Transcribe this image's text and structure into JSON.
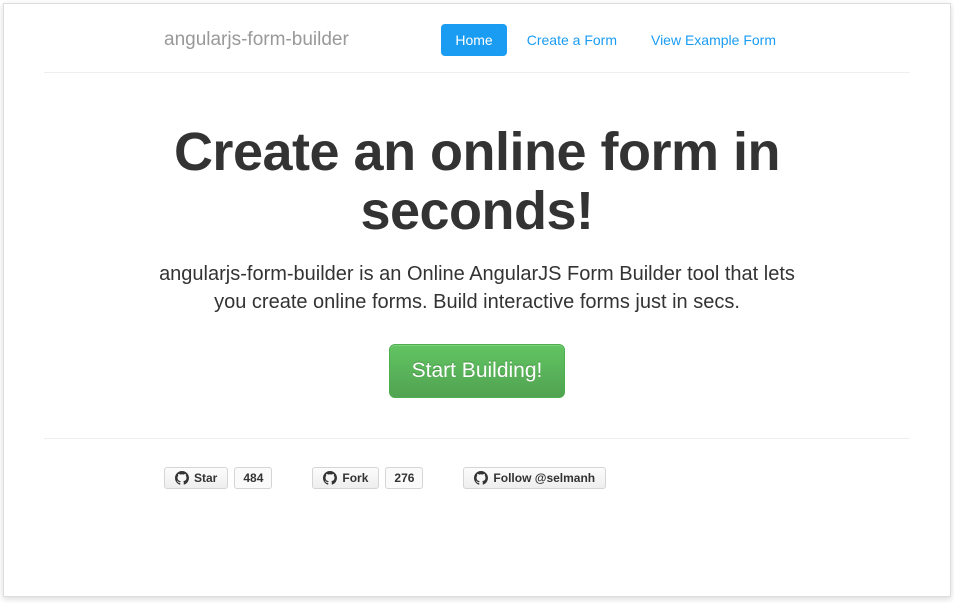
{
  "header": {
    "brand": "angularjs-form-builder",
    "nav": [
      {
        "label": "Home",
        "active": true
      },
      {
        "label": "Create a Form",
        "active": false
      },
      {
        "label": "View Example Form",
        "active": false
      }
    ]
  },
  "hero": {
    "title": "Create an online form in seconds!",
    "subtitle": "angularjs-form-builder is an Online AngularJS Form Builder tool that lets you create online forms. Build interactive forms just in secs.",
    "cta_label": "Start Building!"
  },
  "github": {
    "star": {
      "label": "Star",
      "count": "484"
    },
    "fork": {
      "label": "Fork",
      "count": "276"
    },
    "follow": {
      "label": "Follow @selmanh"
    }
  }
}
